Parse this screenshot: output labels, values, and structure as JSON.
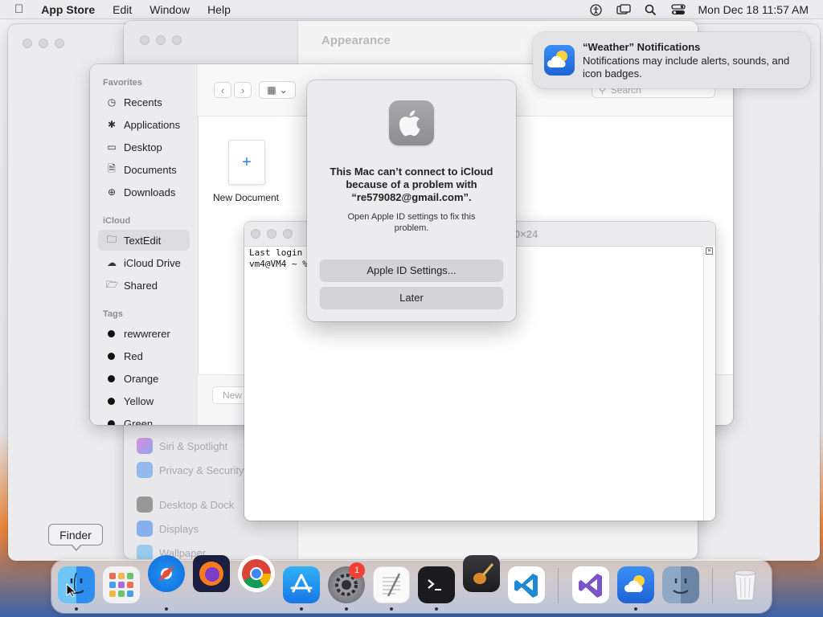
{
  "menubar": {
    "app_name": "App Store",
    "menus": [
      "Edit",
      "Window",
      "Help"
    ],
    "clock": "Mon Dec 18  11:57 AM"
  },
  "settings": {
    "title": "Appearance",
    "items": [
      "Siri & Spotlight",
      "Privacy & Security",
      "Desktop & Dock",
      "Displays",
      "Wallpaper"
    ]
  },
  "finder": {
    "favorites_header": "Favorites",
    "favorites": [
      "Recents",
      "Applications",
      "Desktop",
      "Documents",
      "Downloads"
    ],
    "icloud_header": "iCloud",
    "icloud": [
      "TextEdit",
      "iCloud Drive",
      "Shared"
    ],
    "tags_header": "Tags",
    "tags": [
      "rewwrerer",
      "Red",
      "Orange",
      "Yellow",
      "Green"
    ],
    "search_placeholder": "Search",
    "new_document_label": "New Document",
    "bottom_button": "New"
  },
  "terminal": {
    "title_fragment": "0×24",
    "lines": [
      "Last login",
      "vm4@VM4 ~ %"
    ]
  },
  "dialog": {
    "title": "This Mac can’t connect to iCloud because of a problem with “re579082@gmail.com”.",
    "message": "Open Apple ID settings to fix this problem.",
    "primary_button": "Apple ID Settings...",
    "secondary_button": "Later"
  },
  "notification": {
    "title": "“Weather” Notifications",
    "body": "Notifications may include alerts, sounds, and icon badges."
  },
  "tooltip": "Finder",
  "dock": {
    "items": [
      "finder-icon",
      "launchpad-icon",
      "safari-icon",
      "firefox-icon",
      "chrome-icon",
      "app-store-icon",
      "system-settings-icon",
      "textedit-icon",
      "terminal-icon",
      "garageband-icon",
      "vscode-icon",
      "visual-studio-icon",
      "weather-icon",
      "finder-alt-icon",
      "trash-icon"
    ],
    "settings_badge": "1"
  }
}
